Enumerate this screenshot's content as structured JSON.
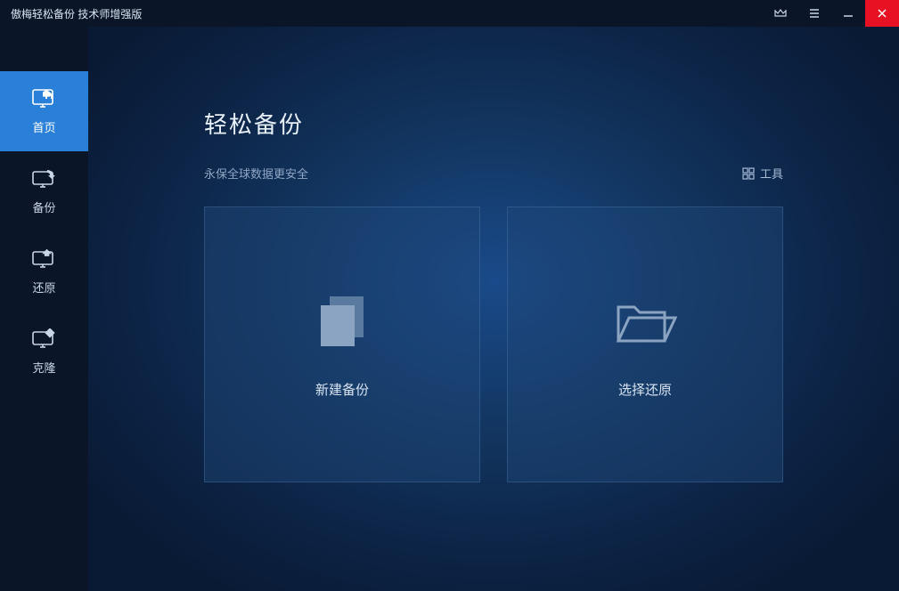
{
  "titlebar": {
    "title": "傲梅轻松备份 技术师增强版"
  },
  "sidebar": {
    "items": [
      {
        "label": "首页"
      },
      {
        "label": "备份"
      },
      {
        "label": "还原"
      },
      {
        "label": "克隆"
      }
    ]
  },
  "main": {
    "page_title": "轻松备份",
    "subtitle": "永保全球数据更安全",
    "tools_label": "工具",
    "cards": [
      {
        "label": "新建备份"
      },
      {
        "label": "选择还原"
      }
    ]
  }
}
